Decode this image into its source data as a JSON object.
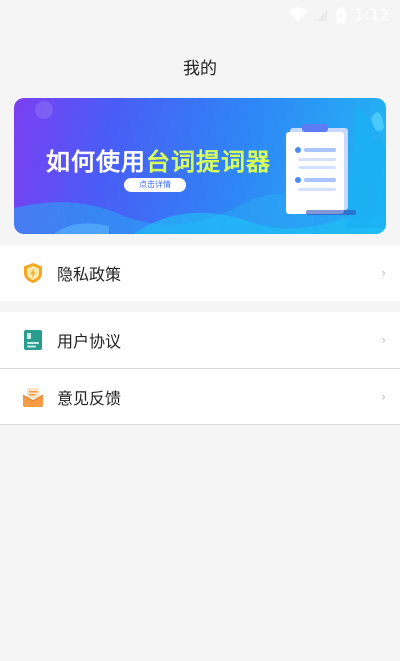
{
  "status_bar": {
    "time": "1:12"
  },
  "page_title": "我的",
  "banner": {
    "title_prefix": "如何使用",
    "title_highlight": "台词提词器",
    "button_label": "点击详情"
  },
  "menu": {
    "privacy": {
      "label": "隐私政策",
      "icon": "shield-icon"
    },
    "agreement": {
      "label": "用户协议",
      "icon": "document-icon"
    },
    "feedback": {
      "label": "意见反馈",
      "icon": "mail-icon"
    }
  },
  "colors": {
    "banner_start": "#7b3ff2",
    "banner_end": "#23b6f4",
    "highlight": "#d7ff5a",
    "shield": "#f5a623",
    "document": "#2a9d8f",
    "mail": "#f59a45"
  }
}
